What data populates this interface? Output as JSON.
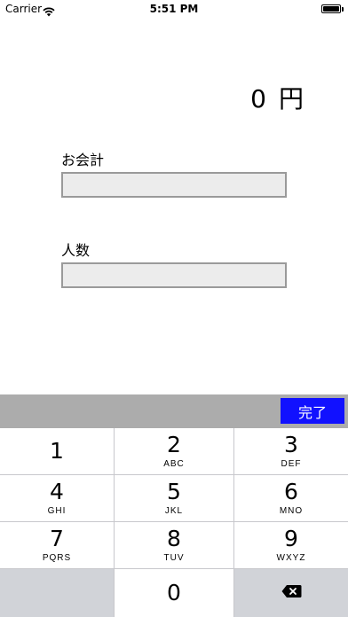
{
  "status_bar": {
    "carrier": "Carrier",
    "time": "5:51 PM"
  },
  "amount": {
    "value": "0",
    "unit": "円"
  },
  "form": {
    "bill_label": "お会計",
    "bill_value": "",
    "people_label": "人数",
    "people_value": ""
  },
  "toolbar": {
    "done_label": "完了",
    "done_color": "#1111ff"
  },
  "keypad": {
    "keys": [
      {
        "num": "1",
        "letters": ""
      },
      {
        "num": "2",
        "letters": "ABC"
      },
      {
        "num": "3",
        "letters": "DEF"
      },
      {
        "num": "4",
        "letters": "GHI"
      },
      {
        "num": "5",
        "letters": "JKL"
      },
      {
        "num": "6",
        "letters": "MNO"
      },
      {
        "num": "7",
        "letters": "PQRS"
      },
      {
        "num": "8",
        "letters": "TUV"
      },
      {
        "num": "9",
        "letters": "WXYZ"
      },
      {
        "num": "0",
        "letters": ""
      }
    ],
    "delete_icon": "backspace-icon"
  }
}
